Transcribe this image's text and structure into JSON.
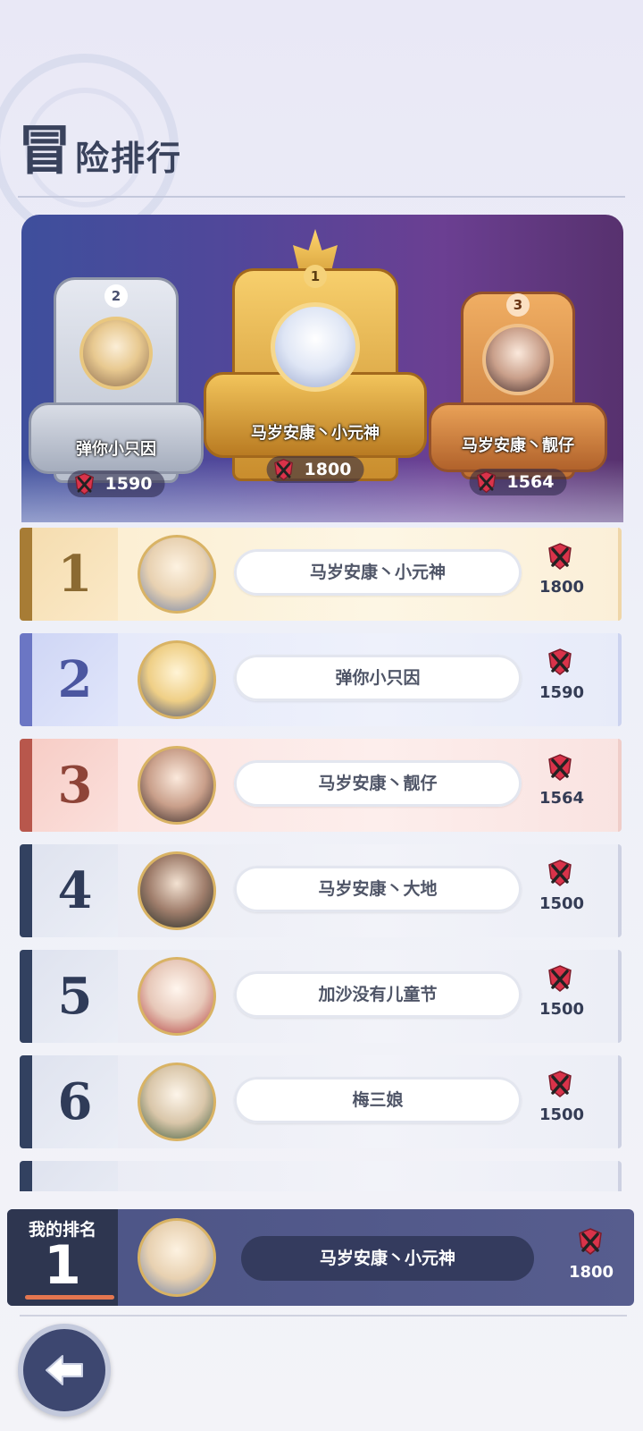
{
  "header": {
    "title_first": "冒",
    "title_rest": "险排行"
  },
  "podium": {
    "first": {
      "rank": "1",
      "name": "马岁安康丶小元神",
      "score": "1800"
    },
    "second": {
      "rank": "2",
      "name": "弹你小只因",
      "score": "1590"
    },
    "third": {
      "rank": "3",
      "name": "马岁安康丶靓仔",
      "score": "1564"
    }
  },
  "leaderboard": [
    {
      "rank": "1",
      "name": "马岁安康丶小元神",
      "score": "1800"
    },
    {
      "rank": "2",
      "name": "弹你小只因",
      "score": "1590"
    },
    {
      "rank": "3",
      "name": "马岁安康丶靓仔",
      "score": "1564"
    },
    {
      "rank": "4",
      "name": "马岁安康丶大地",
      "score": "1500"
    },
    {
      "rank": "5",
      "name": "加沙没有儿童节",
      "score": "1500"
    },
    {
      "rank": "6",
      "name": "梅三娘",
      "score": "1500"
    }
  ],
  "my_rank": {
    "label": "我的排名",
    "rank": "1",
    "name": "马岁安康丶小元神",
    "score": "1800",
    "progress": 1.0
  },
  "icons": {
    "back": "arrow-left-icon",
    "score_badge": "crossed-swords-shield-icon"
  },
  "colors": {
    "gold": "#a77c35",
    "silver": "#6b76c4",
    "bronze": "#b8574c",
    "default_bar": "#324160",
    "badge_red": "#d9334a"
  }
}
